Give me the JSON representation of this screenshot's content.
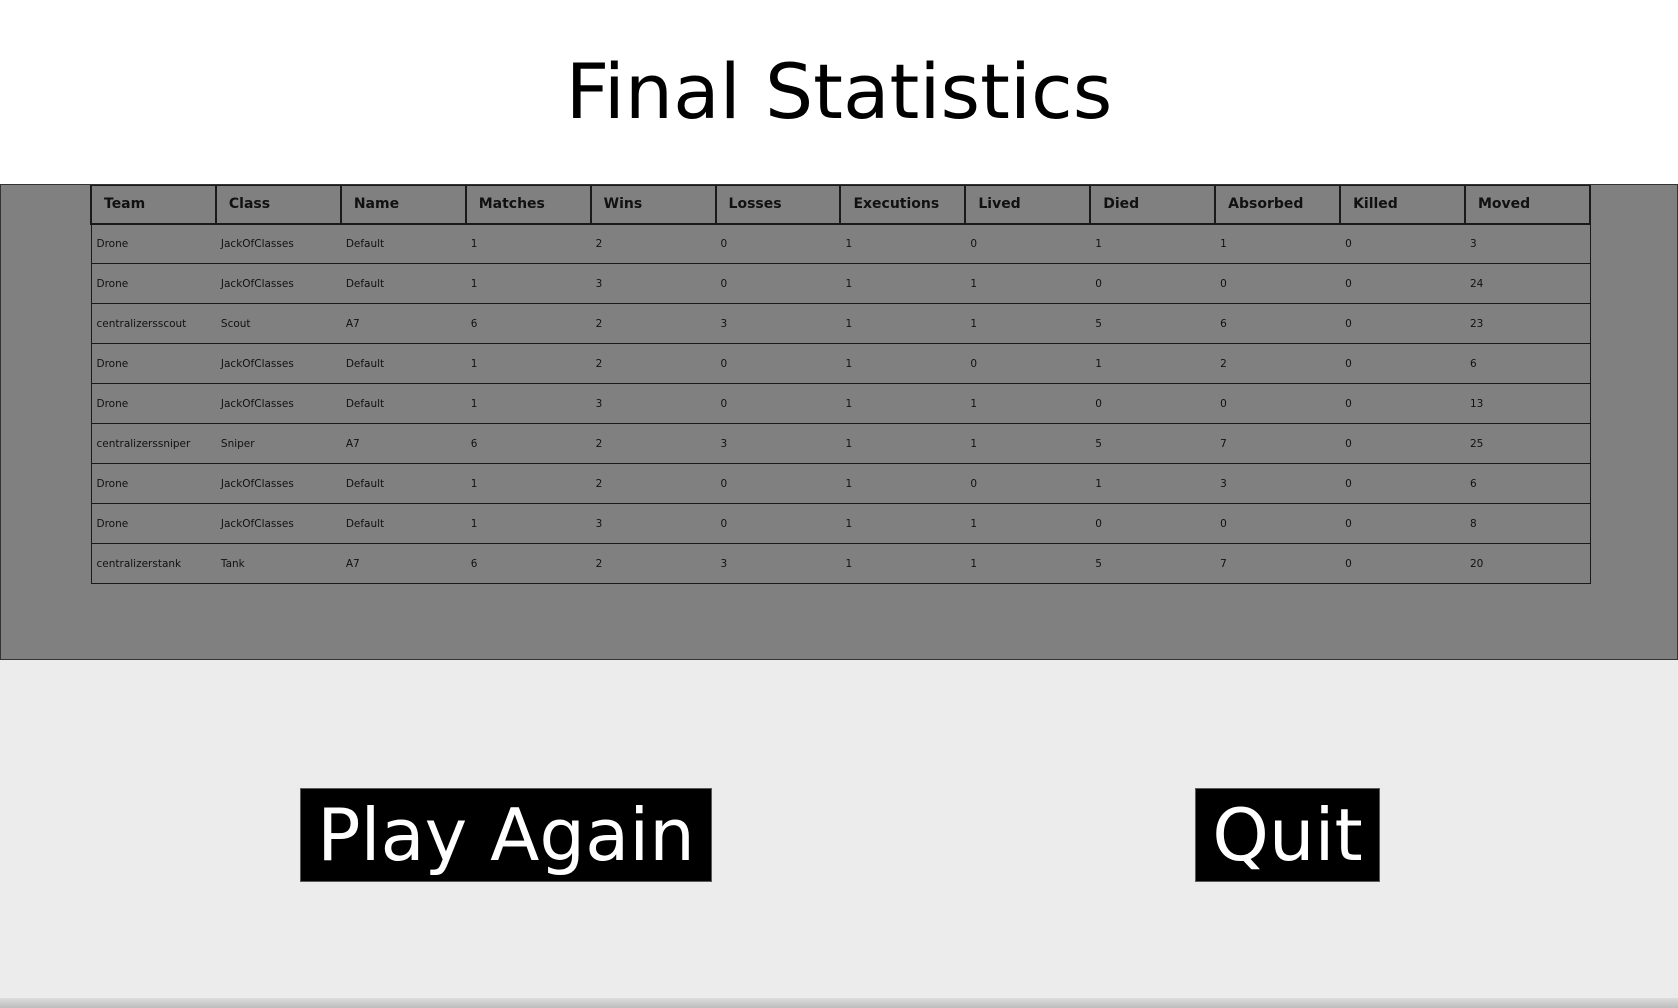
{
  "title": "Final Statistics",
  "table": {
    "headers": [
      "Team",
      "Class",
      "Name",
      "Matches",
      "Wins",
      "Losses",
      "Executions",
      "Lived",
      "Died",
      "Absorbed",
      "Killed",
      "Moved"
    ],
    "rows": [
      [
        "Drone",
        "JackOfClasses",
        "Default",
        "1",
        "2",
        "0",
        "1",
        "0",
        "1",
        "1",
        "0",
        "3"
      ],
      [
        "Drone",
        "JackOfClasses",
        "Default",
        "1",
        "3",
        "0",
        "1",
        "1",
        "0",
        "0",
        "0",
        "24"
      ],
      [
        "centralizersscout",
        "Scout",
        "A7",
        "6",
        "2",
        "3",
        "1",
        "1",
        "5",
        "6",
        "0",
        "23"
      ],
      [
        "Drone",
        "JackOfClasses",
        "Default",
        "1",
        "2",
        "0",
        "1",
        "0",
        "1",
        "2",
        "0",
        "6"
      ],
      [
        "Drone",
        "JackOfClasses",
        "Default",
        "1",
        "3",
        "0",
        "1",
        "1",
        "0",
        "0",
        "0",
        "13"
      ],
      [
        "centralizerssniper",
        "Sniper",
        "A7",
        "6",
        "2",
        "3",
        "1",
        "1",
        "5",
        "7",
        "0",
        "25"
      ],
      [
        "Drone",
        "JackOfClasses",
        "Default",
        "1",
        "2",
        "0",
        "1",
        "0",
        "1",
        "3",
        "0",
        "6"
      ],
      [
        "Drone",
        "JackOfClasses",
        "Default",
        "1",
        "3",
        "0",
        "1",
        "1",
        "0",
        "0",
        "0",
        "8"
      ],
      [
        "centralizerstank",
        "Tank",
        "A7",
        "6",
        "2",
        "3",
        "1",
        "1",
        "5",
        "7",
        "0",
        "20"
      ]
    ]
  },
  "buttons": {
    "play_again": "Play Again",
    "quit": "Quit"
  }
}
